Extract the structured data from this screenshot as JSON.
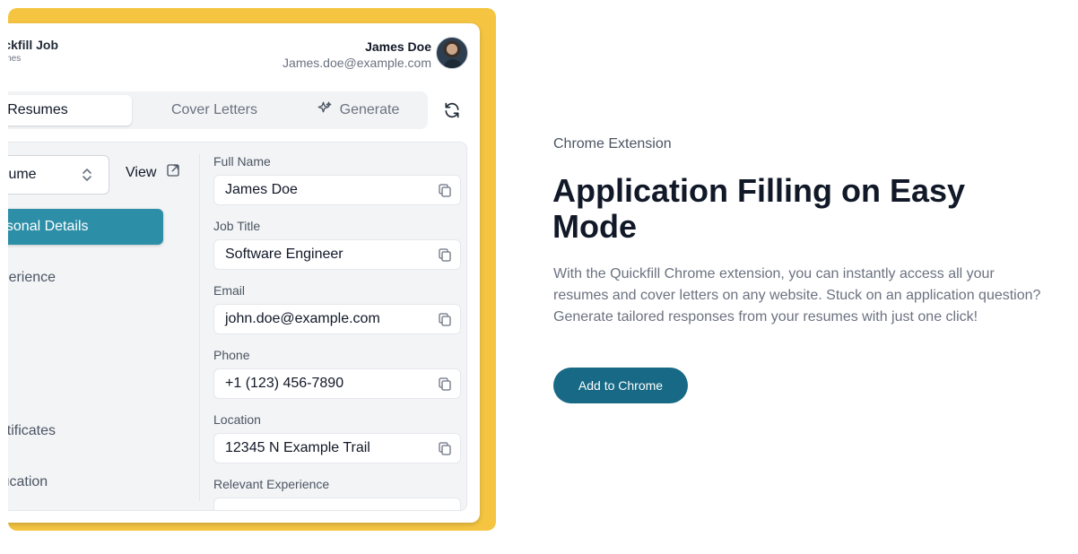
{
  "extension": {
    "brand": {
      "name": "Quickfill Job",
      "sub": "Resumes"
    },
    "user": {
      "name": "James Doe",
      "email": "James.doe@example.com"
    },
    "tabs": [
      {
        "label": "Resumes",
        "active": true,
        "icon": ""
      },
      {
        "label": "Cover Letters",
        "active": false,
        "icon": ""
      },
      {
        "label": "Generate",
        "active": false,
        "icon": "sparkle-icon"
      }
    ],
    "resume_select": "Resume",
    "view_label": "View",
    "sidebar": [
      {
        "label": "Personal Details",
        "active": true
      },
      {
        "label": "Experience",
        "active": false
      },
      {
        "label": "",
        "active": false
      },
      {
        "label": "",
        "active": false
      },
      {
        "label": "Certificates",
        "active": false
      },
      {
        "label": "Education",
        "active": false
      }
    ],
    "fields": [
      {
        "label": "Full Name",
        "value": "James Doe"
      },
      {
        "label": "Job Title",
        "value": "Software Engineer"
      },
      {
        "label": "Email",
        "value": "john.doe@example.com"
      },
      {
        "label": "Phone",
        "value": "+1 (123) 456-7890"
      },
      {
        "label": "Location",
        "value": "12345 N Example Trail"
      },
      {
        "label": "Relevant Experience",
        "value": ""
      }
    ]
  },
  "promo": {
    "eyebrow": "Chrome Extension",
    "headline": "Application Filling on Easy Mode",
    "description": "With the Quickfill Chrome extension, you can instantly access all your resumes and cover letters on any website. Stuck on an application question? Generate tailored responses from your resumes with just one click!",
    "cta": "Add to Chrome"
  },
  "colors": {
    "backdrop": "#f5c542",
    "active_sidebar": "#2d8ea8",
    "cta": "#176985"
  }
}
